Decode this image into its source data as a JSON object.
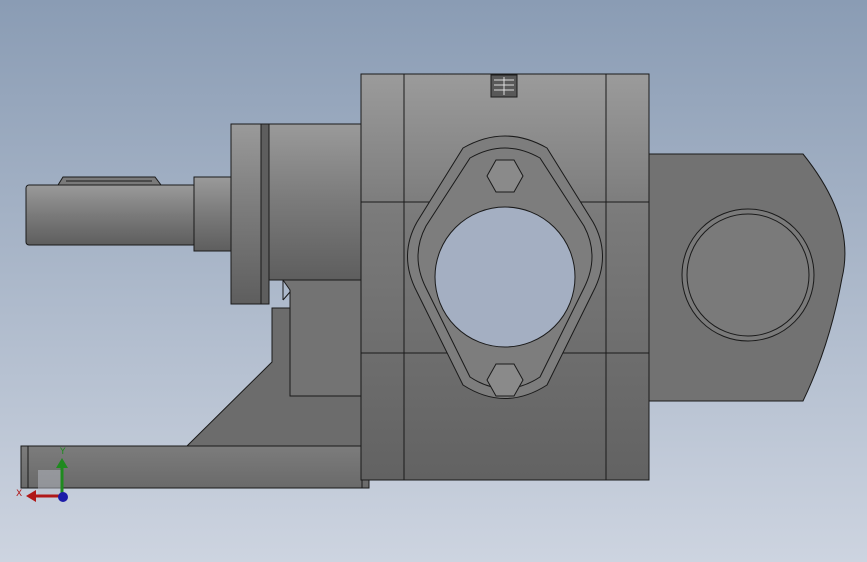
{
  "viewport": {
    "background_top": "#8a9cb4",
    "background_bottom": "#cdd4e0"
  },
  "model": {
    "body_color": "#707070",
    "edge_color": "#1a1a1a",
    "hole_color": "#a4afc2"
  },
  "triad": {
    "x_label": "X",
    "y_label": "Y",
    "x_color": "#b01818",
    "y_color": "#1f8a1f",
    "z_color": "#1c1ca8"
  }
}
